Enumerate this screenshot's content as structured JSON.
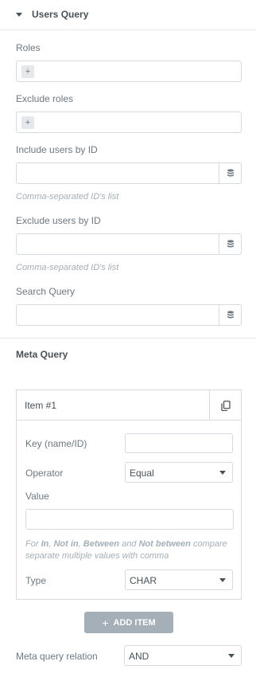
{
  "section": {
    "title": "Users Query"
  },
  "roles": {
    "label": "Roles",
    "add_glyph": "+"
  },
  "exclude_roles": {
    "label": "Exclude roles",
    "add_glyph": "+"
  },
  "include_ids": {
    "label": "Include users by ID",
    "hint": "Comma-separated ID's list",
    "value": ""
  },
  "exclude_ids": {
    "label": "Exclude users by ID",
    "hint": "Comma-separated ID's list",
    "value": ""
  },
  "search_query": {
    "label": "Search Query",
    "value": ""
  },
  "meta_query": {
    "heading": "Meta Query",
    "item": {
      "title": "Item #1",
      "key_label": "Key (name/ID)",
      "key_value": "",
      "operator_label": "Operator",
      "operator_value": "Equal",
      "value_label": "Value",
      "value_value": "",
      "hint_parts": {
        "p1": "For ",
        "b1": "In",
        "p2": ", ",
        "b2": "Not in",
        "p3": ", ",
        "b3": "Between",
        "p4": " and ",
        "b4": "Not between",
        "p5": " compare separate multiple values with comma"
      },
      "type_label": "Type",
      "type_value": "CHAR"
    },
    "add_item_label": "ADD ITEM",
    "add_item_glyph": "+",
    "relation_label": "Meta query relation",
    "relation_value": "AND"
  },
  "icons": {
    "caret": "caret-down-icon",
    "dynamic": "database-icon",
    "duplicate": "duplicate-icon",
    "select_arrow": "chevron-down-icon"
  },
  "colors": {
    "text": "#495157",
    "label": "#6d7882",
    "hint": "#a4afb7",
    "border": "#d5dadf",
    "button_bg": "#a4afb7"
  }
}
